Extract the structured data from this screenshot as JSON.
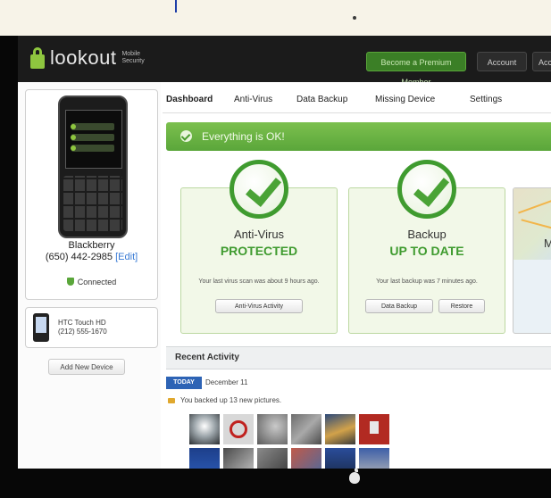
{
  "topbar": {
    "logo_text": "lookout",
    "logo_sub1": "Mobile",
    "logo_sub2": "Security",
    "premium_button": "Become a Premium Member",
    "account_button": "Account",
    "more_button": "Acc"
  },
  "sidebar": {
    "device_name": "Blackberry",
    "device_phone": "(650) 442-2985",
    "device_phone_link": "[Edit]",
    "device_status": "Connected",
    "device2_name": "HTC Touch HD",
    "device2_number": "(212) 555-1670",
    "add_device": "Add New Device",
    "phone_rows": [
      "Find",
      "Backup",
      "Protect"
    ]
  },
  "tabs": [
    "Dashboard",
    "Anti-Virus",
    "Data Backup",
    "Missing Device",
    "Settings"
  ],
  "status_bar": {
    "text": "Everything is OK!"
  },
  "cards": [
    {
      "title": "Anti-Virus",
      "state": "PROTECTED",
      "note": "Your last virus scan was about 9 hours ago.",
      "buttons": [
        "Anti-Virus Activity"
      ]
    },
    {
      "title": "Backup",
      "state": "UP TO DATE",
      "note": "Your last backup was 7 minutes ago.",
      "buttons": [
        "Data Backup",
        "Restore"
      ]
    }
  ],
  "map_card": {
    "letter": "M"
  },
  "recent_activity": {
    "title": "Recent Activity",
    "date_badge": "TODAY",
    "date_text": "December 11",
    "entry": "You backed up 13 new pictures."
  },
  "colors": {
    "accent_green": "#5aa63a",
    "link_blue": "#3a7bd5",
    "topbar_dark": "#1b1b1b"
  }
}
